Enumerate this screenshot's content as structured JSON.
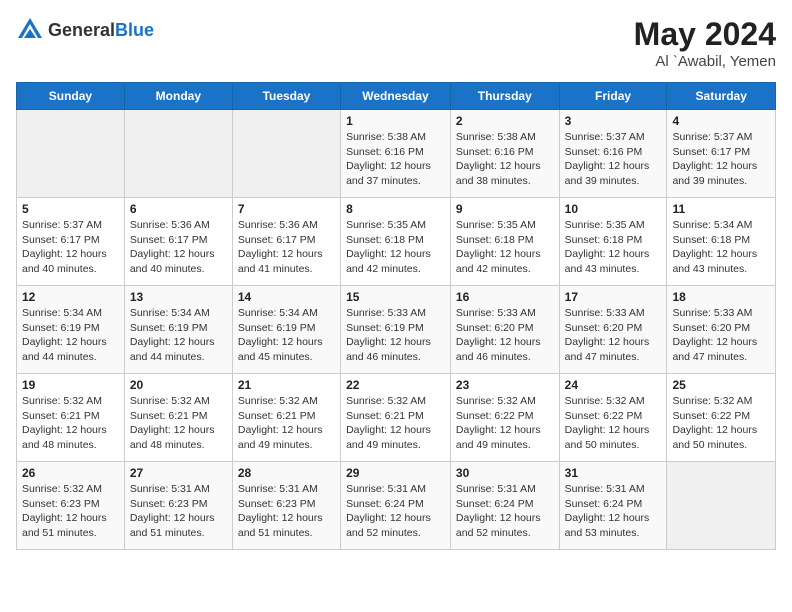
{
  "header": {
    "logo_general": "General",
    "logo_blue": "Blue",
    "month_year": "May 2024",
    "location": "Al `Awabil, Yemen"
  },
  "weekdays": [
    "Sunday",
    "Monday",
    "Tuesday",
    "Wednesday",
    "Thursday",
    "Friday",
    "Saturday"
  ],
  "weeks": [
    [
      {
        "day": "",
        "info": ""
      },
      {
        "day": "",
        "info": ""
      },
      {
        "day": "",
        "info": ""
      },
      {
        "day": "1",
        "info": "Sunrise: 5:38 AM\nSunset: 6:16 PM\nDaylight: 12 hours\nand 37 minutes."
      },
      {
        "day": "2",
        "info": "Sunrise: 5:38 AM\nSunset: 6:16 PM\nDaylight: 12 hours\nand 38 minutes."
      },
      {
        "day": "3",
        "info": "Sunrise: 5:37 AM\nSunset: 6:16 PM\nDaylight: 12 hours\nand 39 minutes."
      },
      {
        "day": "4",
        "info": "Sunrise: 5:37 AM\nSunset: 6:17 PM\nDaylight: 12 hours\nand 39 minutes."
      }
    ],
    [
      {
        "day": "5",
        "info": "Sunrise: 5:37 AM\nSunset: 6:17 PM\nDaylight: 12 hours\nand 40 minutes."
      },
      {
        "day": "6",
        "info": "Sunrise: 5:36 AM\nSunset: 6:17 PM\nDaylight: 12 hours\nand 40 minutes."
      },
      {
        "day": "7",
        "info": "Sunrise: 5:36 AM\nSunset: 6:17 PM\nDaylight: 12 hours\nand 41 minutes."
      },
      {
        "day": "8",
        "info": "Sunrise: 5:35 AM\nSunset: 6:18 PM\nDaylight: 12 hours\nand 42 minutes."
      },
      {
        "day": "9",
        "info": "Sunrise: 5:35 AM\nSunset: 6:18 PM\nDaylight: 12 hours\nand 42 minutes."
      },
      {
        "day": "10",
        "info": "Sunrise: 5:35 AM\nSunset: 6:18 PM\nDaylight: 12 hours\nand 43 minutes."
      },
      {
        "day": "11",
        "info": "Sunrise: 5:34 AM\nSunset: 6:18 PM\nDaylight: 12 hours\nand 43 minutes."
      }
    ],
    [
      {
        "day": "12",
        "info": "Sunrise: 5:34 AM\nSunset: 6:19 PM\nDaylight: 12 hours\nand 44 minutes."
      },
      {
        "day": "13",
        "info": "Sunrise: 5:34 AM\nSunset: 6:19 PM\nDaylight: 12 hours\nand 44 minutes."
      },
      {
        "day": "14",
        "info": "Sunrise: 5:34 AM\nSunset: 6:19 PM\nDaylight: 12 hours\nand 45 minutes."
      },
      {
        "day": "15",
        "info": "Sunrise: 5:33 AM\nSunset: 6:19 PM\nDaylight: 12 hours\nand 46 minutes."
      },
      {
        "day": "16",
        "info": "Sunrise: 5:33 AM\nSunset: 6:20 PM\nDaylight: 12 hours\nand 46 minutes."
      },
      {
        "day": "17",
        "info": "Sunrise: 5:33 AM\nSunset: 6:20 PM\nDaylight: 12 hours\nand 47 minutes."
      },
      {
        "day": "18",
        "info": "Sunrise: 5:33 AM\nSunset: 6:20 PM\nDaylight: 12 hours\nand 47 minutes."
      }
    ],
    [
      {
        "day": "19",
        "info": "Sunrise: 5:32 AM\nSunset: 6:21 PM\nDaylight: 12 hours\nand 48 minutes."
      },
      {
        "day": "20",
        "info": "Sunrise: 5:32 AM\nSunset: 6:21 PM\nDaylight: 12 hours\nand 48 minutes."
      },
      {
        "day": "21",
        "info": "Sunrise: 5:32 AM\nSunset: 6:21 PM\nDaylight: 12 hours\nand 49 minutes."
      },
      {
        "day": "22",
        "info": "Sunrise: 5:32 AM\nSunset: 6:21 PM\nDaylight: 12 hours\nand 49 minutes."
      },
      {
        "day": "23",
        "info": "Sunrise: 5:32 AM\nSunset: 6:22 PM\nDaylight: 12 hours\nand 49 minutes."
      },
      {
        "day": "24",
        "info": "Sunrise: 5:32 AM\nSunset: 6:22 PM\nDaylight: 12 hours\nand 50 minutes."
      },
      {
        "day": "25",
        "info": "Sunrise: 5:32 AM\nSunset: 6:22 PM\nDaylight: 12 hours\nand 50 minutes."
      }
    ],
    [
      {
        "day": "26",
        "info": "Sunrise: 5:32 AM\nSunset: 6:23 PM\nDaylight: 12 hours\nand 51 minutes."
      },
      {
        "day": "27",
        "info": "Sunrise: 5:31 AM\nSunset: 6:23 PM\nDaylight: 12 hours\nand 51 minutes."
      },
      {
        "day": "28",
        "info": "Sunrise: 5:31 AM\nSunset: 6:23 PM\nDaylight: 12 hours\nand 51 minutes."
      },
      {
        "day": "29",
        "info": "Sunrise: 5:31 AM\nSunset: 6:24 PM\nDaylight: 12 hours\nand 52 minutes."
      },
      {
        "day": "30",
        "info": "Sunrise: 5:31 AM\nSunset: 6:24 PM\nDaylight: 12 hours\nand 52 minutes."
      },
      {
        "day": "31",
        "info": "Sunrise: 5:31 AM\nSunset: 6:24 PM\nDaylight: 12 hours\nand 53 minutes."
      },
      {
        "day": "",
        "info": ""
      }
    ]
  ]
}
